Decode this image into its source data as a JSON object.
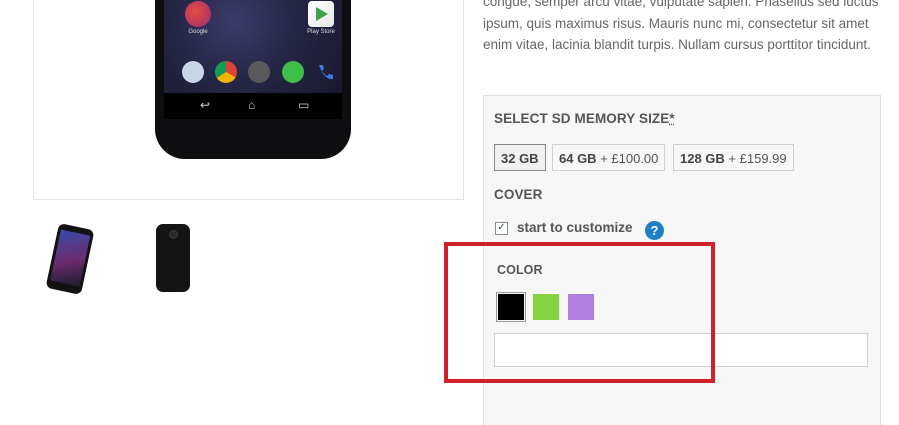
{
  "product": {
    "description": "congue, semper arcu vitae, vulputate sapien. Phasellus sed luctus ipsum, quis maximus risus. Mauris nunc mi, consectetur sit amet enim vitae, lacinia blandit turpis. Nullam cursus porttitor tincidunt.",
    "screen_apps": {
      "app1_label": "Google",
      "app2_label": "Play Store"
    }
  },
  "options": {
    "memory": {
      "title": "SELECT SD MEMORY SIZE",
      "required_mark": "*",
      "choices": [
        {
          "size": "32 GB",
          "price": ""
        },
        {
          "size": "64 GB",
          "price": " + £100.00"
        },
        {
          "size": "128 GB",
          "price": " + £159.99"
        }
      ],
      "selected": "32 GB"
    },
    "cover": {
      "title": "COVER",
      "checkbox_label": "start to customize",
      "checked": true,
      "help_glyph": "?"
    },
    "color": {
      "title": "COLOR",
      "swatches": [
        {
          "name": "black",
          "hex": "#000000"
        },
        {
          "name": "green",
          "hex": "#84d442"
        },
        {
          "name": "purple",
          "hex": "#b07ee0"
        }
      ],
      "input_value": "",
      "input_placeholder": ""
    }
  },
  "colors": {
    "highlight": "#d0202a",
    "help_icon": "#1e7fc4"
  }
}
